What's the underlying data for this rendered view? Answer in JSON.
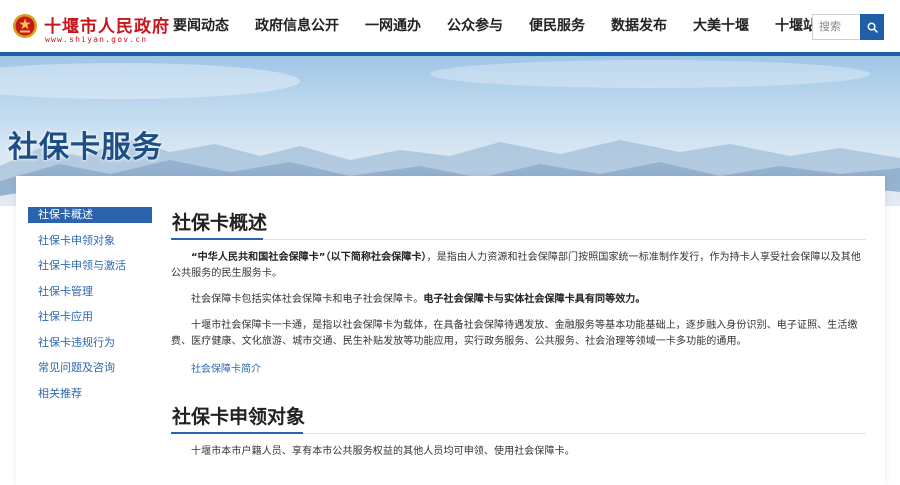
{
  "header": {
    "logo_title": "十堰市人民政府",
    "logo_url": "www.shiyan.gov.cn",
    "nav": [
      {
        "label": "要闻动态"
      },
      {
        "label": "政府信息公开"
      },
      {
        "label": "一网通办"
      },
      {
        "label": "公众参与"
      },
      {
        "label": "便民服务"
      },
      {
        "label": "数据发布"
      },
      {
        "label": "大美十堰"
      },
      {
        "label": "十堰站群"
      }
    ],
    "search_placeholder": "搜索"
  },
  "banner": {
    "title": "社保卡服务"
  },
  "sidebar": {
    "items": [
      {
        "label": "社保卡概述"
      },
      {
        "label": "社保卡申领对象"
      },
      {
        "label": "社保卡申领与激活"
      },
      {
        "label": "社保卡管理"
      },
      {
        "label": "社保卡应用"
      },
      {
        "label": "社保卡违规行为"
      },
      {
        "label": "常见问题及咨询"
      },
      {
        "label": "相关推荐"
      }
    ],
    "active_index": 0
  },
  "content": {
    "sections": [
      {
        "title": "社保卡概述",
        "p1_bold": "“中华人民共和国社会保障卡”（以下简称社会保障卡）",
        "p1_rest": "，是指由人力资源和社会保障部门按照国家统一标准制作发行，作为持卡人享受社会保障以及其他公共服务的民生服务卡。",
        "p2_plain": "社会保障卡包括实体社会保障卡和电子社会保障卡。",
        "p2_bold": "电子社会保障卡与实体社会保障卡具有同等效力。",
        "p3": "十堰市社会保障卡一卡通，是指以社会保障卡为载体，在具备社会保障待遇发放、金融服务等基本功能基础上，逐步融入身份识别、电子证照、生活缴费、医疗健康、文化旅游、城市交通、民生补贴发放等功能应用，实行政务服务、公共服务、社会治理等领域一卡多功能的通用。",
        "link": "社会保障卡简介"
      },
      {
        "title": "社保卡申领对象",
        "p1": "十堰市本市户籍人员、享有本市公共服务权益的其他人员均可申领、使用社会保障卡。"
      }
    ]
  },
  "colors": {
    "brand_blue": "#1f5fa8",
    "logo_red": "#c8161d",
    "link_blue": "#2e67b1"
  },
  "icons": {
    "emblem": "national-emblem-icon",
    "search": "search-icon"
  }
}
